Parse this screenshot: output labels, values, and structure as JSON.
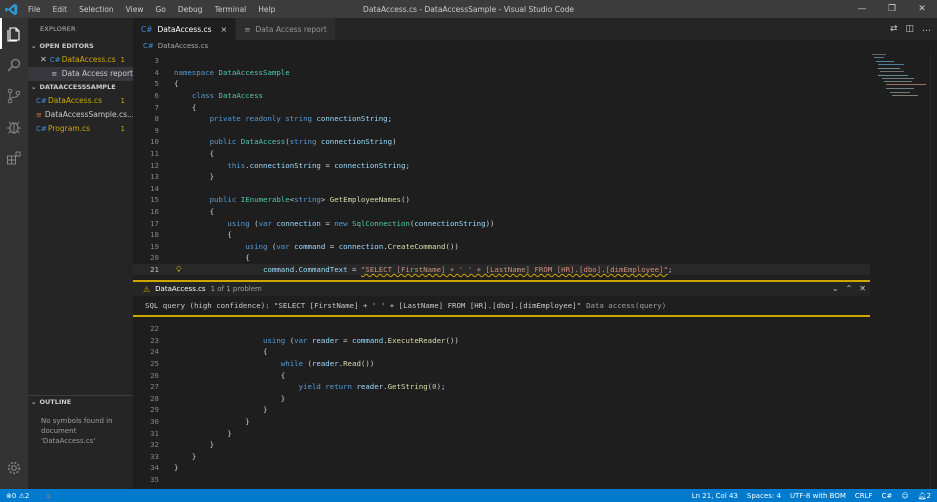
{
  "window": {
    "title": "DataAccess.cs - DataAccessSample - Visual Studio Code",
    "menu": [
      "File",
      "Edit",
      "Selection",
      "View",
      "Go",
      "Debug",
      "Terminal",
      "Help"
    ],
    "controls": [
      "—",
      "❐",
      "✕"
    ]
  },
  "sidebar": {
    "title": "EXPLORER",
    "open_editors_label": "OPEN EDITORS",
    "open_editors": [
      {
        "icon": "C#",
        "label": "DataAccess.cs",
        "badge": "1"
      },
      {
        "icon": "≡",
        "label": "Data Access report",
        "badge": ""
      }
    ],
    "project_label": "DATAACCESSSAMPLE",
    "project_files": [
      {
        "icon": "C#",
        "label": "DataAccess.cs",
        "badge": "1"
      },
      {
        "icon": "≡",
        "label": "DataAccessSample.cs...",
        "badge": ""
      },
      {
        "icon": "C#",
        "label": "Program.cs",
        "badge": "1"
      }
    ],
    "outline_label": "OUTLINE",
    "outline_message": "No symbols found in document 'DataAccess.cs'"
  },
  "tabs": [
    {
      "icon": "C#",
      "label": "DataAccess.cs",
      "close": "×"
    },
    {
      "icon": "≡",
      "label": "Data Access report"
    }
  ],
  "tab_actions": [
    "⇄",
    "◫",
    "…"
  ],
  "breadcrumb": {
    "icon": "C#",
    "label": "DataAccess.cs"
  },
  "code_top": [
    {
      "n": "3",
      "t": ""
    },
    {
      "n": "4",
      "t": "namespace DataAccessSample"
    },
    {
      "n": "5",
      "t": "{"
    },
    {
      "n": "6",
      "t": "    class DataAccess"
    },
    {
      "n": "7",
      "t": "    {"
    },
    {
      "n": "8",
      "t": "        private readonly string connectionString;"
    },
    {
      "n": "9",
      "t": ""
    },
    {
      "n": "10",
      "t": "        public DataAccess(string connectionString)"
    },
    {
      "n": "11",
      "t": "        {"
    },
    {
      "n": "12",
      "t": "            this.connectionString = connectionString;"
    },
    {
      "n": "13",
      "t": "        }"
    },
    {
      "n": "14",
      "t": ""
    },
    {
      "n": "15",
      "t": "        public IEnumerable<string> GetEmployeeNames()"
    },
    {
      "n": "16",
      "t": "        {"
    },
    {
      "n": "17",
      "t": "            using (var connection = new SqlConnection(connectionString))"
    },
    {
      "n": "18",
      "t": "            {"
    },
    {
      "n": "19",
      "t": "                using (var command = connection.CreateCommand())"
    },
    {
      "n": "20",
      "t": "                {"
    },
    {
      "n": "21",
      "t": "                    command.CommandText = \"SELECT [FirstName] + ' ' + [LastName] FROM [HR].[dbo].[dimEmployee]\";"
    }
  ],
  "peek": {
    "file": "DataAccess.cs",
    "count": "1 of 1 problem",
    "message": "SQL query (high confidence): \"SELECT [FirstName] + ' ' + [LastName] FROM [HR].[dbo].[dimEmployee]\"",
    "source": "Data access(query)",
    "actions": [
      "⌄",
      "⌃",
      "✕"
    ]
  },
  "code_bottom": [
    {
      "n": "22",
      "t": ""
    },
    {
      "n": "23",
      "t": "                    using (var reader = command.ExecuteReader())"
    },
    {
      "n": "24",
      "t": "                    {"
    },
    {
      "n": "25",
      "t": "                        while (reader.Read())"
    },
    {
      "n": "26",
      "t": "                        {"
    },
    {
      "n": "27",
      "t": "                            yield return reader.GetString(0);"
    },
    {
      "n": "28",
      "t": "                        }"
    },
    {
      "n": "29",
      "t": "                    }"
    },
    {
      "n": "30",
      "t": "                }"
    },
    {
      "n": "31",
      "t": "            }"
    },
    {
      "n": "32",
      "t": "        }"
    },
    {
      "n": "33",
      "t": "    }"
    },
    {
      "n": "34",
      "t": "}"
    },
    {
      "n": "35",
      "t": ""
    }
  ],
  "statusbar": {
    "errors": "0",
    "warnings": "2",
    "position": "Ln 21, Col 43",
    "spaces": "Spaces: 4",
    "encoding": "UTF-8 with BOM",
    "eol": "CRLF",
    "language": "C#",
    "notifications": "2"
  },
  "colors": {
    "accent": "#007acc",
    "warning": "#cca700",
    "keyword": "#569cd6",
    "type": "#4ec9b0",
    "string": "#ce9178"
  }
}
